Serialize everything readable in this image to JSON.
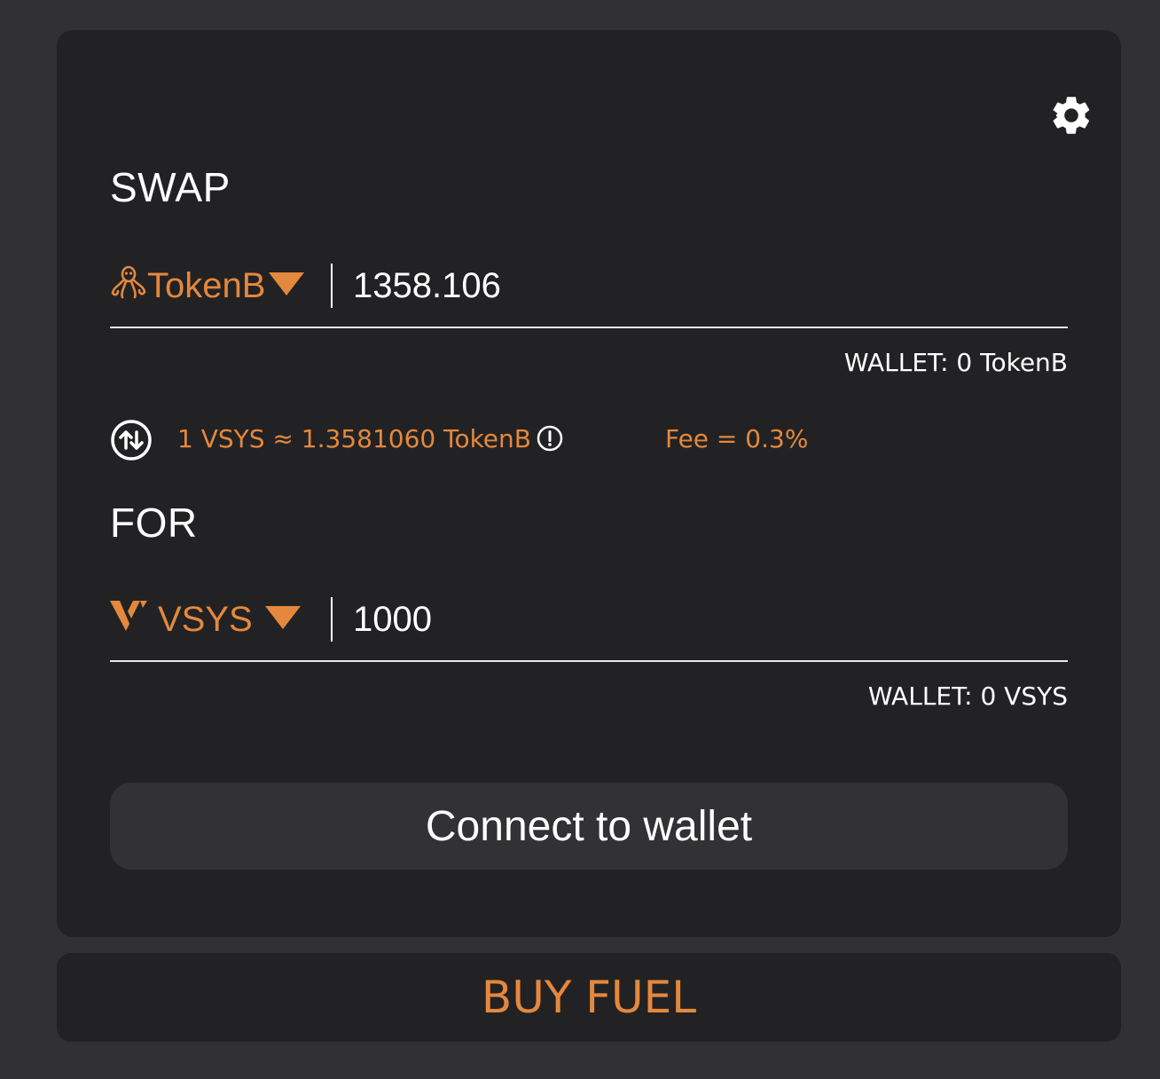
{
  "colors": {
    "page_background": "#313133",
    "card_background": "#222224",
    "accent": "#e4883d",
    "text": "#ffffff",
    "button_background": "#323234"
  },
  "settings": {
    "icon": "gear-icon"
  },
  "swap": {
    "label": "SWAP",
    "token_symbol": "TokenB",
    "token_icon": "octopus-icon",
    "amount": "1358.106",
    "wallet_text": "WALLET: 0 TokenB"
  },
  "rate": {
    "switch_icon": "swap-arrows-icon",
    "text": "1 VSYS ≈ 1.3581060 TokenB",
    "info_icon": "info-icon",
    "fee_text": "Fee = 0.3%"
  },
  "for": {
    "label": "FOR",
    "token_symbol": "VSYS",
    "token_icon": "vsys-logo-icon",
    "amount": "1000",
    "wallet_text": "WALLET: 0 VSYS"
  },
  "connect_button": {
    "label": "Connect to wallet"
  },
  "buy_fuel_button": {
    "label": "BUY FUEL"
  }
}
